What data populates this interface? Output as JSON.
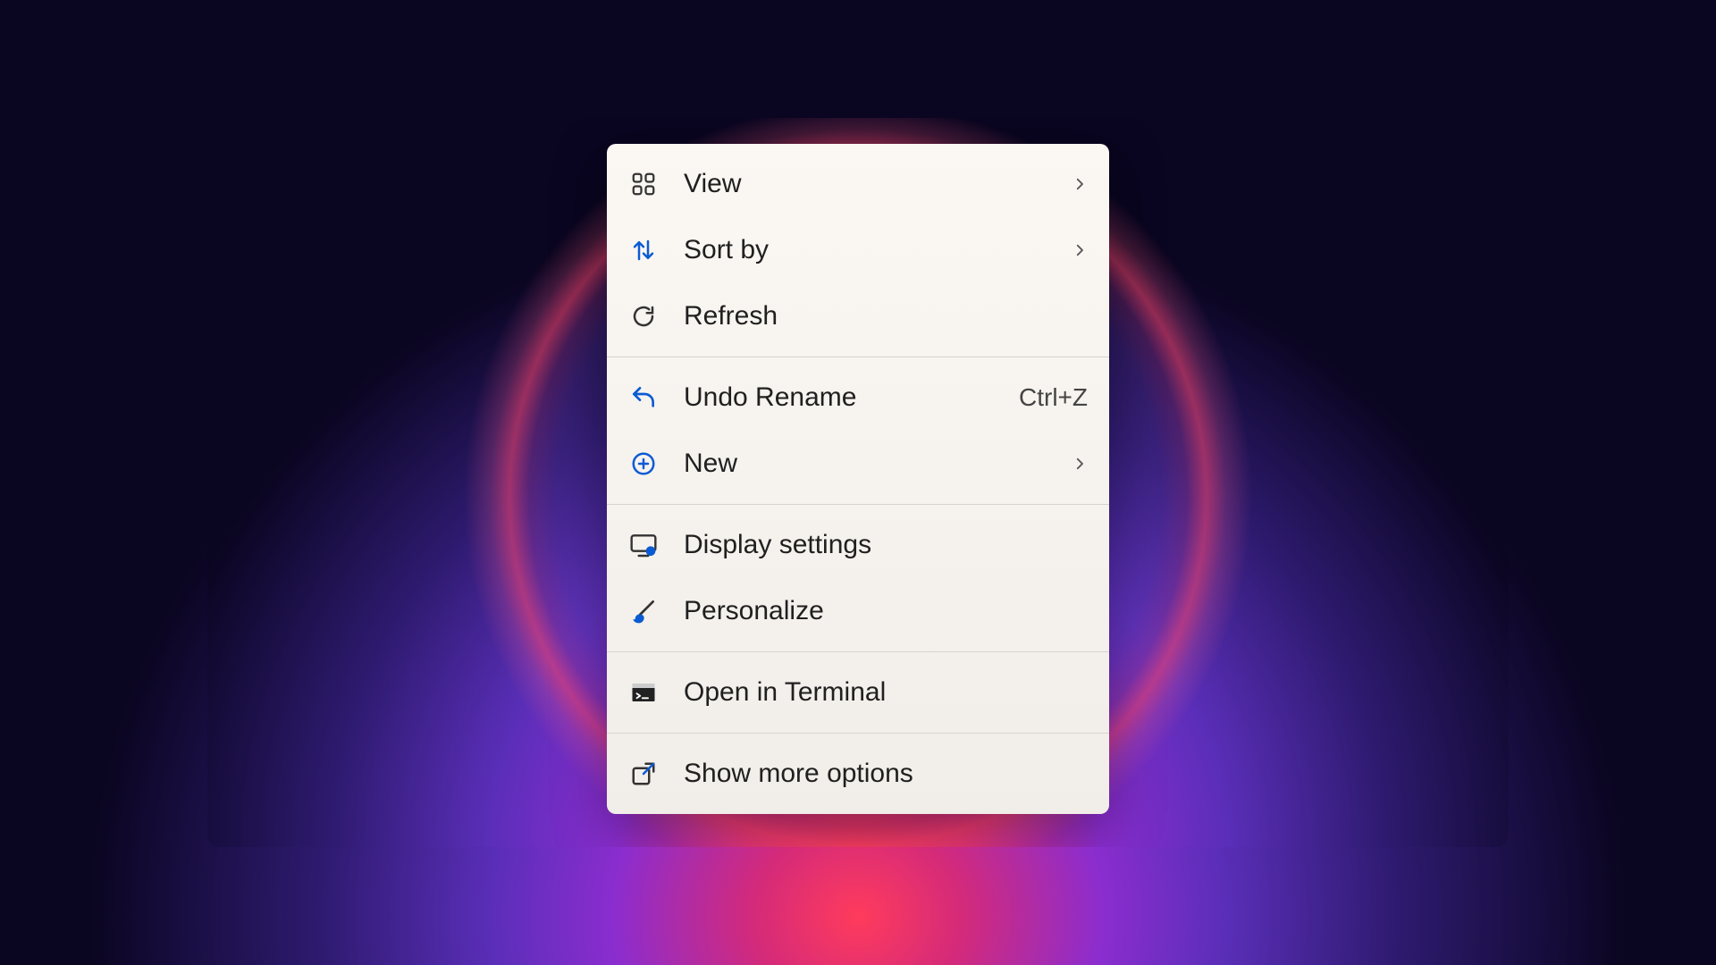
{
  "menu": {
    "items": [
      {
        "icon": "grid-icon",
        "label": "View",
        "submenu": true
      },
      {
        "icon": "sort-icon",
        "label": "Sort by",
        "submenu": true
      },
      {
        "icon": "refresh-icon",
        "label": "Refresh"
      },
      {
        "separator": true
      },
      {
        "icon": "undo-icon",
        "label": "Undo Rename",
        "shortcut": "Ctrl+Z"
      },
      {
        "icon": "new-icon",
        "label": "New",
        "submenu": true
      },
      {
        "separator": true
      },
      {
        "icon": "display-icon",
        "label": "Display settings"
      },
      {
        "icon": "brush-icon",
        "label": "Personalize"
      },
      {
        "separator": true
      },
      {
        "icon": "terminal-icon",
        "label": "Open in Terminal"
      },
      {
        "separator": true
      },
      {
        "icon": "expand-icon",
        "label": "Show more options"
      }
    ]
  },
  "icons": {
    "grid-icon": "<svg width='30' height='30' viewBox='0 0 24 24' fill='none' stroke='#333' stroke-width='1.8'><rect x='3' y='3' width='7' height='7' rx='2'/><rect x='14' y='3' width='7' height='7' rx='2'/><rect x='3' y='14' width='7' height='7' rx='2'/><rect x='14' y='14' width='7' height='7' rx='2'/></svg>",
    "sort-icon": "<svg width='30' height='30' viewBox='0 0 24 24' fill='none' stroke='#0a5bd3' stroke-width='2' stroke-linecap='round' stroke-linejoin='round'><path d='M8 20V5'/><path d='M4 9l4-4 4 4' fill='none'/><path d='M16 4v15'/><path d='M20 15l-4 4-4-4' fill='none'/></svg>",
    "refresh-icon": "<svg width='30' height='30' viewBox='0 0 24 24' fill='none' stroke='#333' stroke-width='2' stroke-linecap='round'><path d='M20 12a8 8 0 1 1-3-6.2'/><path d='M20 4v5h-5'/></svg>",
    "undo-icon": "<svg width='32' height='32' viewBox='0 0 24 24' fill='none' stroke='#0a5bd3' stroke-width='2' stroke-linecap='round' stroke-linejoin='round'><path d='M9 14 4 9l5-5'/><path d='M4 9h9a7 7 0 0 1 7 7v3'/></svg>",
    "new-icon": "<svg width='30' height='30' viewBox='0 0 24 24' fill='none' stroke='#0a5bd3' stroke-width='2'><circle cx='12' cy='12' r='9'/><path d='M12 8v8M8 12h8' stroke-linecap='round'/></svg>",
    "display-icon": "<svg width='32' height='32' viewBox='0 0 24 24' fill='none'><rect x='2' y='4' width='20' height='13' rx='2' stroke='#333' stroke-width='1.8'/><path d='M8 21h8' stroke='#333' stroke-width='1.8' stroke-linecap='round'/><circle cx='18' cy='17' r='4' fill='#0a5bd3'/><path d='M18 14.5v5M15.5 17h5' stroke='white' stroke-width='1' opacity='0'/><path d='M18 13.8l.9 1.6 1.8.3-1.3 1.3.3 1.8-1.7-.9-1.7.9.3-1.8-1.3-1.3 1.8-.3z' fill='#0a5bd3' stroke='white' stroke-width='0.3' opacity='0'/></svg>",
    "brush-icon": "<svg width='32' height='32' viewBox='0 0 24 24' fill='none' stroke-linecap='round'><path d='M20 4 9 15' stroke='#333' stroke-width='2'/><path d='M9 15c-2 0-3.5 1.5-3.5 3.5 0 .7-.8 1-1.5 1 1 1.5 2.8 2 4 2 2.2 0 4-1.8 4-4 0-1-1-2.5-3-2.5z' fill='#0a5bd3' stroke='#0a5bd3' stroke-width='1'/></svg>",
    "terminal-icon": "<svg width='30' height='30' viewBox='0 0 24 24'><rect x='2' y='4' width='20' height='16' rx='1' fill='#222'/><rect x='2' y='4' width='20' height='4' fill='#ccc'/><path d='M6 13l3 2-3 2' stroke='white' stroke-width='1.5' fill='none' stroke-linecap='round' stroke-linejoin='round'/><path d='M11 17h5' stroke='white' stroke-width='1.5' stroke-linecap='round'/></svg>",
    "expand-icon": "<svg width='30' height='30' viewBox='0 0 24 24' fill='none' stroke='#333' stroke-width='2' stroke-linecap='round' stroke-linejoin='round'><rect x='3' y='7' width='14' height='14' rx='2'/><path d='M14 3h7v7'/><path d='M21 3 12 12' stroke='#0a5bd3'/></svg>",
    "chevron": "<svg width='18' height='18' viewBox='0 0 24 24' fill='none' stroke='#555' stroke-width='2.5' stroke-linecap='round' stroke-linejoin='round'><path d='M9 5l7 7-7 7'/></svg>"
  }
}
